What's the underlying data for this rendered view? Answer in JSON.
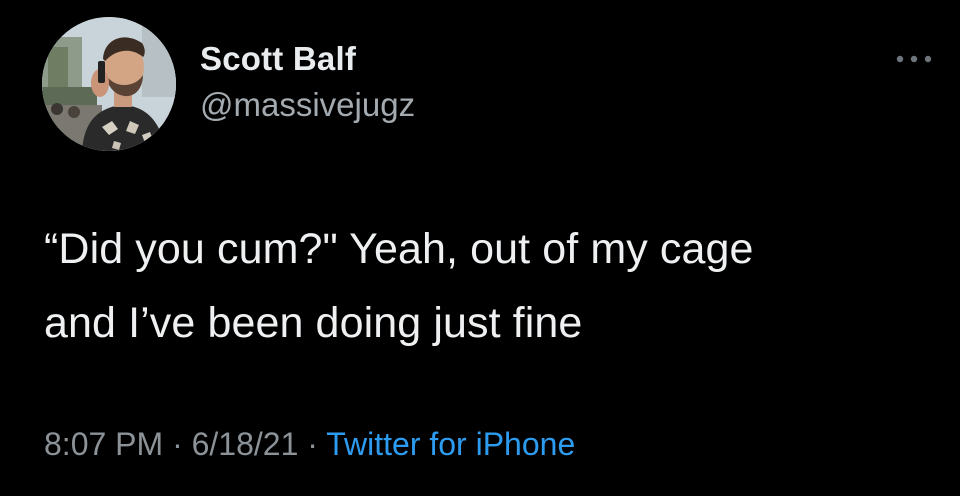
{
  "user": {
    "display_name": "Scott Balf",
    "handle": "@massivejugz"
  },
  "tweet": {
    "line1": "“Did you cum?\" Yeah, out of my cage",
    "line2": "and I’ve been doing just fine"
  },
  "meta": {
    "time": "8:07 PM",
    "sep1": " · ",
    "date": "6/18/21",
    "sep2": " · ",
    "source": "Twitter for iPhone"
  },
  "colors": {
    "background": "#000000",
    "name": "#e9ecee",
    "handle": "#a3aab0",
    "meta": "#8b9298",
    "link": "#2d9cf0"
  },
  "icons": {
    "more": "more-horizontal-icon",
    "avatar": "profile-photo"
  }
}
